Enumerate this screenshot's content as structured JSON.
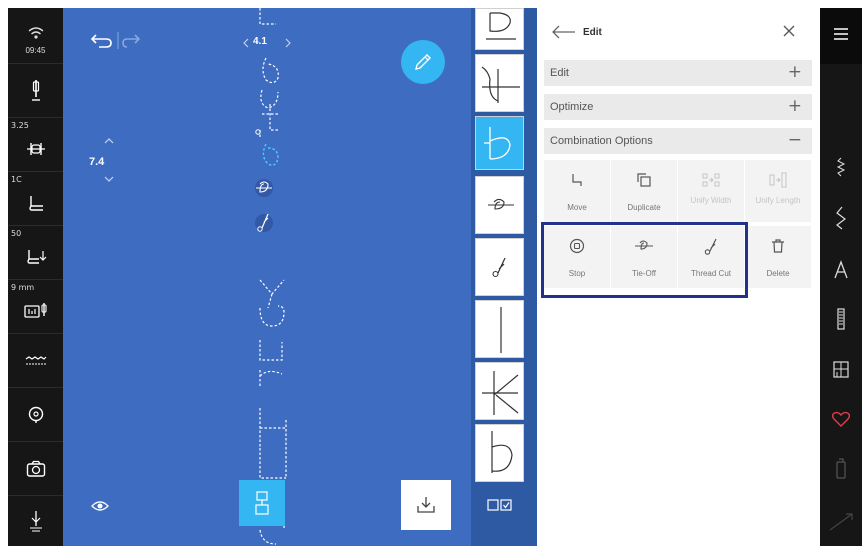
{
  "status": {
    "time": "09:45"
  },
  "left_sidebar": {
    "items": [
      {
        "name": "wifi-status",
        "icon": "wifi-icon"
      },
      {
        "name": "needle",
        "icon": "needle-icon"
      },
      {
        "name": "stitch-width",
        "value": "3.25",
        "icon": "stitch-width-icon"
      },
      {
        "name": "presser-foot",
        "value": "1C",
        "icon": "presser-foot-icon"
      },
      {
        "name": "presser-foot-pressure",
        "value": "50",
        "icon": "foot-pressure-icon"
      },
      {
        "name": "stabilizer",
        "value": "9 mm",
        "icon": "stitch-plate-icon"
      },
      {
        "name": "feed-dogs",
        "icon": "feed-dog-icon"
      },
      {
        "name": "bobbin",
        "icon": "bobbin-icon"
      },
      {
        "name": "camera",
        "icon": "camera-icon"
      },
      {
        "name": "needle-stop",
        "icon": "needle-position-icon"
      }
    ]
  },
  "canvas": {
    "zoom_value": "7.4",
    "stitch_index": "4.1",
    "bg_color": "#3d6cc0"
  },
  "panel": {
    "title": "Edit",
    "sections": [
      {
        "label": "Edit",
        "state": "+"
      },
      {
        "label": "Optimize",
        "state": "+"
      },
      {
        "label": "Combination Options",
        "state": "−"
      }
    ],
    "combination_buttons": [
      {
        "label": "Move",
        "icon": "move-icon",
        "enabled": true
      },
      {
        "label": "Duplicate",
        "icon": "duplicate-icon",
        "enabled": true
      },
      {
        "label": "Unify Width",
        "icon": "unify-width-icon",
        "enabled": false
      },
      {
        "label": "Unify Length",
        "icon": "unify-length-icon",
        "enabled": false
      },
      {
        "label": "Stop",
        "icon": "stop-icon",
        "enabled": true
      },
      {
        "label": "Tie-Off",
        "icon": "tie-off-icon",
        "enabled": true
      },
      {
        "label": "Thread Cut",
        "icon": "thread-cut-icon",
        "enabled": true
      },
      {
        "label": "Delete",
        "icon": "trash-icon",
        "enabled": true
      }
    ]
  },
  "colors": {
    "accent": "#33b6f2",
    "highlight_border": "#23318b",
    "heart": "#e03b4a"
  }
}
